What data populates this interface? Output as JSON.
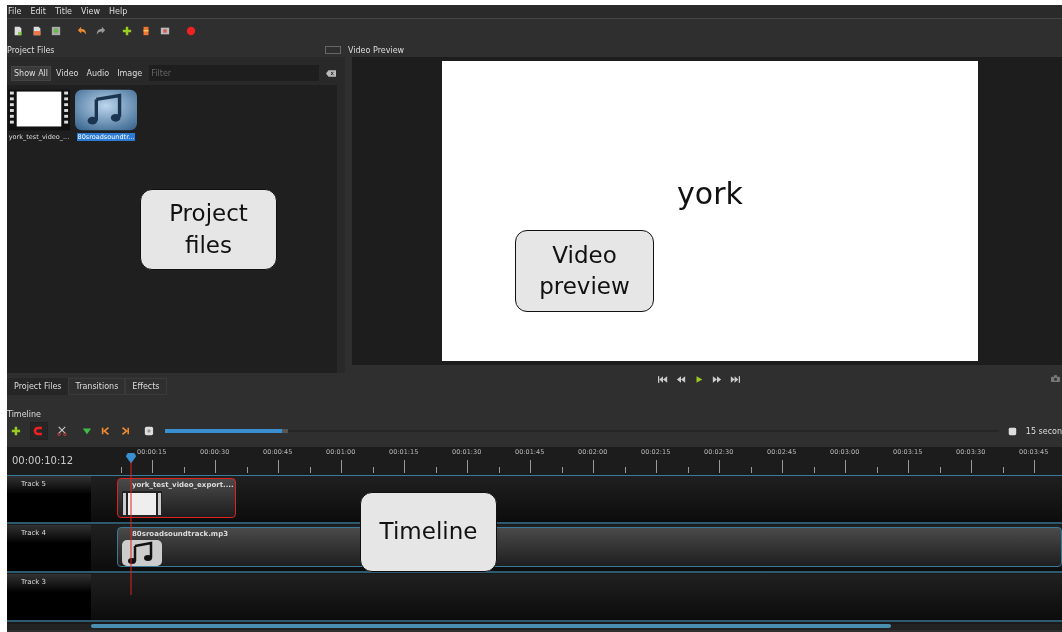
{
  "menu": [
    "File",
    "Edit",
    "Title",
    "View",
    "Help"
  ],
  "project_files": {
    "title": "Project Files",
    "filters": [
      {
        "label": "Show All",
        "selected": true
      },
      {
        "label": "Video",
        "selected": false
      },
      {
        "label": "Audio",
        "selected": false
      },
      {
        "label": "Image",
        "selected": false
      }
    ],
    "filter_placeholder": "Filter",
    "files": [
      {
        "name": "york_test_video_...",
        "kind": "video",
        "selected": false
      },
      {
        "name": "80sroadsoundtr...",
        "kind": "audio",
        "selected": true
      }
    ]
  },
  "video_preview": {
    "title": "Video Preview",
    "frame_text": "york"
  },
  "bottom_tabs": [
    {
      "label": "Project Files",
      "selected": true
    },
    {
      "label": "Transitions",
      "selected": false
    },
    {
      "label": "Effects",
      "selected": false
    }
  ],
  "timeline": {
    "title": "Timeline",
    "time": "00:00:10:12",
    "zoom": {
      "level": 0.14,
      "label": "15 secon"
    },
    "ruler": [
      "00:00:15",
      "00:00:30",
      "00:00:45",
      "00:01:00",
      "00:01:15",
      "00:01:30",
      "00:01:45",
      "00:02:00",
      "00:02:15",
      "00:02:30",
      "00:02:45",
      "00:03:00",
      "00:03:15",
      "00:03:30",
      "00:03:45"
    ],
    "tracks": [
      {
        "name": "Track 5",
        "clip": {
          "name": "york_test_video_export....",
          "kind": "video",
          "selected": true
        }
      },
      {
        "name": "Track 4",
        "clip": {
          "name": "80sroadsoundtrack.mp3",
          "kind": "audio",
          "selected": false
        }
      },
      {
        "name": "Track 3"
      }
    ]
  },
  "callouts": [
    {
      "text": "Project files",
      "kind": "files"
    },
    {
      "text": "Video preview",
      "kind": "preview"
    },
    {
      "text": "Timeline",
      "kind": "timeline"
    }
  ]
}
